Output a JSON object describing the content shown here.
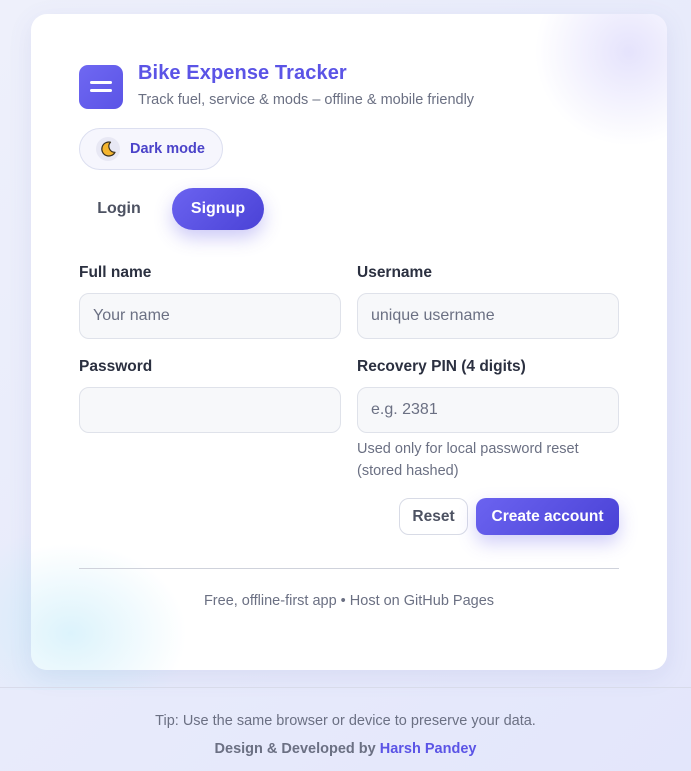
{
  "app": {
    "title": "Bike Expense Tracker",
    "subtitle": "Track fuel, service & mods – offline & mobile friendly",
    "logo_icon": "menu-lines-icon"
  },
  "theme_toggle": {
    "label": "Dark mode",
    "icon": "crescent-moon-icon"
  },
  "tabs": [
    {
      "label": "Login",
      "active": false
    },
    {
      "label": "Signup",
      "active": true
    }
  ],
  "form": {
    "full_name": {
      "label": "Full name",
      "placeholder": "Your name",
      "value": ""
    },
    "username": {
      "label": "Username",
      "placeholder": "unique username",
      "value": ""
    },
    "password": {
      "label": "Password",
      "placeholder": "",
      "value": ""
    },
    "recovery_pin": {
      "label": "Recovery PIN (4 digits)",
      "placeholder": "e.g. 2381",
      "value": "",
      "hint": "Used only for local password reset (stored hashed)"
    },
    "reset_label": "Reset",
    "submit_label": "Create account"
  },
  "card_footer": "Free, offline-first app • Host on GitHub Pages",
  "page_footer": {
    "tip": "Tip: Use the same browser or device to preserve your data.",
    "credit_prefix": "Design & Developed by",
    "author": "Harsh Pandey"
  },
  "colors": {
    "accent": "#5b54e6",
    "accent_dark": "#4a42d6",
    "muted_text": "#6b7083",
    "input_bg": "#f7f8fa"
  }
}
